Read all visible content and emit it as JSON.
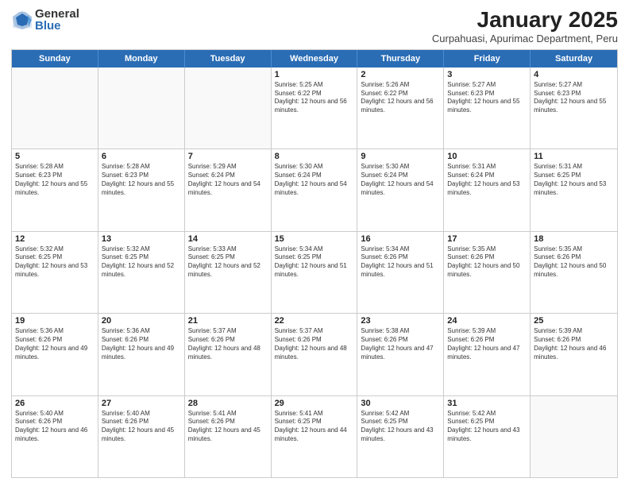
{
  "header": {
    "logo": {
      "general": "General",
      "blue": "Blue"
    },
    "title": "January 2025",
    "subtitle": "Curpahuasi, Apurimac Department, Peru"
  },
  "weekdays": [
    "Sunday",
    "Monday",
    "Tuesday",
    "Wednesday",
    "Thursday",
    "Friday",
    "Saturday"
  ],
  "weeks": [
    [
      {
        "day": "",
        "sunrise": "",
        "sunset": "",
        "daylight": "",
        "empty": true
      },
      {
        "day": "",
        "sunrise": "",
        "sunset": "",
        "daylight": "",
        "empty": true
      },
      {
        "day": "",
        "sunrise": "",
        "sunset": "",
        "daylight": "",
        "empty": true
      },
      {
        "day": "1",
        "sunrise": "Sunrise: 5:25 AM",
        "sunset": "Sunset: 6:22 PM",
        "daylight": "Daylight: 12 hours and 56 minutes."
      },
      {
        "day": "2",
        "sunrise": "Sunrise: 5:26 AM",
        "sunset": "Sunset: 6:22 PM",
        "daylight": "Daylight: 12 hours and 56 minutes."
      },
      {
        "day": "3",
        "sunrise": "Sunrise: 5:27 AM",
        "sunset": "Sunset: 6:23 PM",
        "daylight": "Daylight: 12 hours and 55 minutes."
      },
      {
        "day": "4",
        "sunrise": "Sunrise: 5:27 AM",
        "sunset": "Sunset: 6:23 PM",
        "daylight": "Daylight: 12 hours and 55 minutes."
      }
    ],
    [
      {
        "day": "5",
        "sunrise": "Sunrise: 5:28 AM",
        "sunset": "Sunset: 6:23 PM",
        "daylight": "Daylight: 12 hours and 55 minutes."
      },
      {
        "day": "6",
        "sunrise": "Sunrise: 5:28 AM",
        "sunset": "Sunset: 6:23 PM",
        "daylight": "Daylight: 12 hours and 55 minutes."
      },
      {
        "day": "7",
        "sunrise": "Sunrise: 5:29 AM",
        "sunset": "Sunset: 6:24 PM",
        "daylight": "Daylight: 12 hours and 54 minutes."
      },
      {
        "day": "8",
        "sunrise": "Sunrise: 5:30 AM",
        "sunset": "Sunset: 6:24 PM",
        "daylight": "Daylight: 12 hours and 54 minutes."
      },
      {
        "day": "9",
        "sunrise": "Sunrise: 5:30 AM",
        "sunset": "Sunset: 6:24 PM",
        "daylight": "Daylight: 12 hours and 54 minutes."
      },
      {
        "day": "10",
        "sunrise": "Sunrise: 5:31 AM",
        "sunset": "Sunset: 6:24 PM",
        "daylight": "Daylight: 12 hours and 53 minutes."
      },
      {
        "day": "11",
        "sunrise": "Sunrise: 5:31 AM",
        "sunset": "Sunset: 6:25 PM",
        "daylight": "Daylight: 12 hours and 53 minutes."
      }
    ],
    [
      {
        "day": "12",
        "sunrise": "Sunrise: 5:32 AM",
        "sunset": "Sunset: 6:25 PM",
        "daylight": "Daylight: 12 hours and 53 minutes."
      },
      {
        "day": "13",
        "sunrise": "Sunrise: 5:32 AM",
        "sunset": "Sunset: 6:25 PM",
        "daylight": "Daylight: 12 hours and 52 minutes."
      },
      {
        "day": "14",
        "sunrise": "Sunrise: 5:33 AM",
        "sunset": "Sunset: 6:25 PM",
        "daylight": "Daylight: 12 hours and 52 minutes."
      },
      {
        "day": "15",
        "sunrise": "Sunrise: 5:34 AM",
        "sunset": "Sunset: 6:25 PM",
        "daylight": "Daylight: 12 hours and 51 minutes."
      },
      {
        "day": "16",
        "sunrise": "Sunrise: 5:34 AM",
        "sunset": "Sunset: 6:26 PM",
        "daylight": "Daylight: 12 hours and 51 minutes."
      },
      {
        "day": "17",
        "sunrise": "Sunrise: 5:35 AM",
        "sunset": "Sunset: 6:26 PM",
        "daylight": "Daylight: 12 hours and 50 minutes."
      },
      {
        "day": "18",
        "sunrise": "Sunrise: 5:35 AM",
        "sunset": "Sunset: 6:26 PM",
        "daylight": "Daylight: 12 hours and 50 minutes."
      }
    ],
    [
      {
        "day": "19",
        "sunrise": "Sunrise: 5:36 AM",
        "sunset": "Sunset: 6:26 PM",
        "daylight": "Daylight: 12 hours and 49 minutes."
      },
      {
        "day": "20",
        "sunrise": "Sunrise: 5:36 AM",
        "sunset": "Sunset: 6:26 PM",
        "daylight": "Daylight: 12 hours and 49 minutes."
      },
      {
        "day": "21",
        "sunrise": "Sunrise: 5:37 AM",
        "sunset": "Sunset: 6:26 PM",
        "daylight": "Daylight: 12 hours and 48 minutes."
      },
      {
        "day": "22",
        "sunrise": "Sunrise: 5:37 AM",
        "sunset": "Sunset: 6:26 PM",
        "daylight": "Daylight: 12 hours and 48 minutes."
      },
      {
        "day": "23",
        "sunrise": "Sunrise: 5:38 AM",
        "sunset": "Sunset: 6:26 PM",
        "daylight": "Daylight: 12 hours and 47 minutes."
      },
      {
        "day": "24",
        "sunrise": "Sunrise: 5:39 AM",
        "sunset": "Sunset: 6:26 PM",
        "daylight": "Daylight: 12 hours and 47 minutes."
      },
      {
        "day": "25",
        "sunrise": "Sunrise: 5:39 AM",
        "sunset": "Sunset: 6:26 PM",
        "daylight": "Daylight: 12 hours and 46 minutes."
      }
    ],
    [
      {
        "day": "26",
        "sunrise": "Sunrise: 5:40 AM",
        "sunset": "Sunset: 6:26 PM",
        "daylight": "Daylight: 12 hours and 46 minutes."
      },
      {
        "day": "27",
        "sunrise": "Sunrise: 5:40 AM",
        "sunset": "Sunset: 6:26 PM",
        "daylight": "Daylight: 12 hours and 45 minutes."
      },
      {
        "day": "28",
        "sunrise": "Sunrise: 5:41 AM",
        "sunset": "Sunset: 6:26 PM",
        "daylight": "Daylight: 12 hours and 45 minutes."
      },
      {
        "day": "29",
        "sunrise": "Sunrise: 5:41 AM",
        "sunset": "Sunset: 6:25 PM",
        "daylight": "Daylight: 12 hours and 44 minutes."
      },
      {
        "day": "30",
        "sunrise": "Sunrise: 5:42 AM",
        "sunset": "Sunset: 6:25 PM",
        "daylight": "Daylight: 12 hours and 43 minutes."
      },
      {
        "day": "31",
        "sunrise": "Sunrise: 5:42 AM",
        "sunset": "Sunset: 6:25 PM",
        "daylight": "Daylight: 12 hours and 43 minutes."
      },
      {
        "day": "",
        "sunrise": "",
        "sunset": "",
        "daylight": "",
        "empty": true
      }
    ]
  ]
}
